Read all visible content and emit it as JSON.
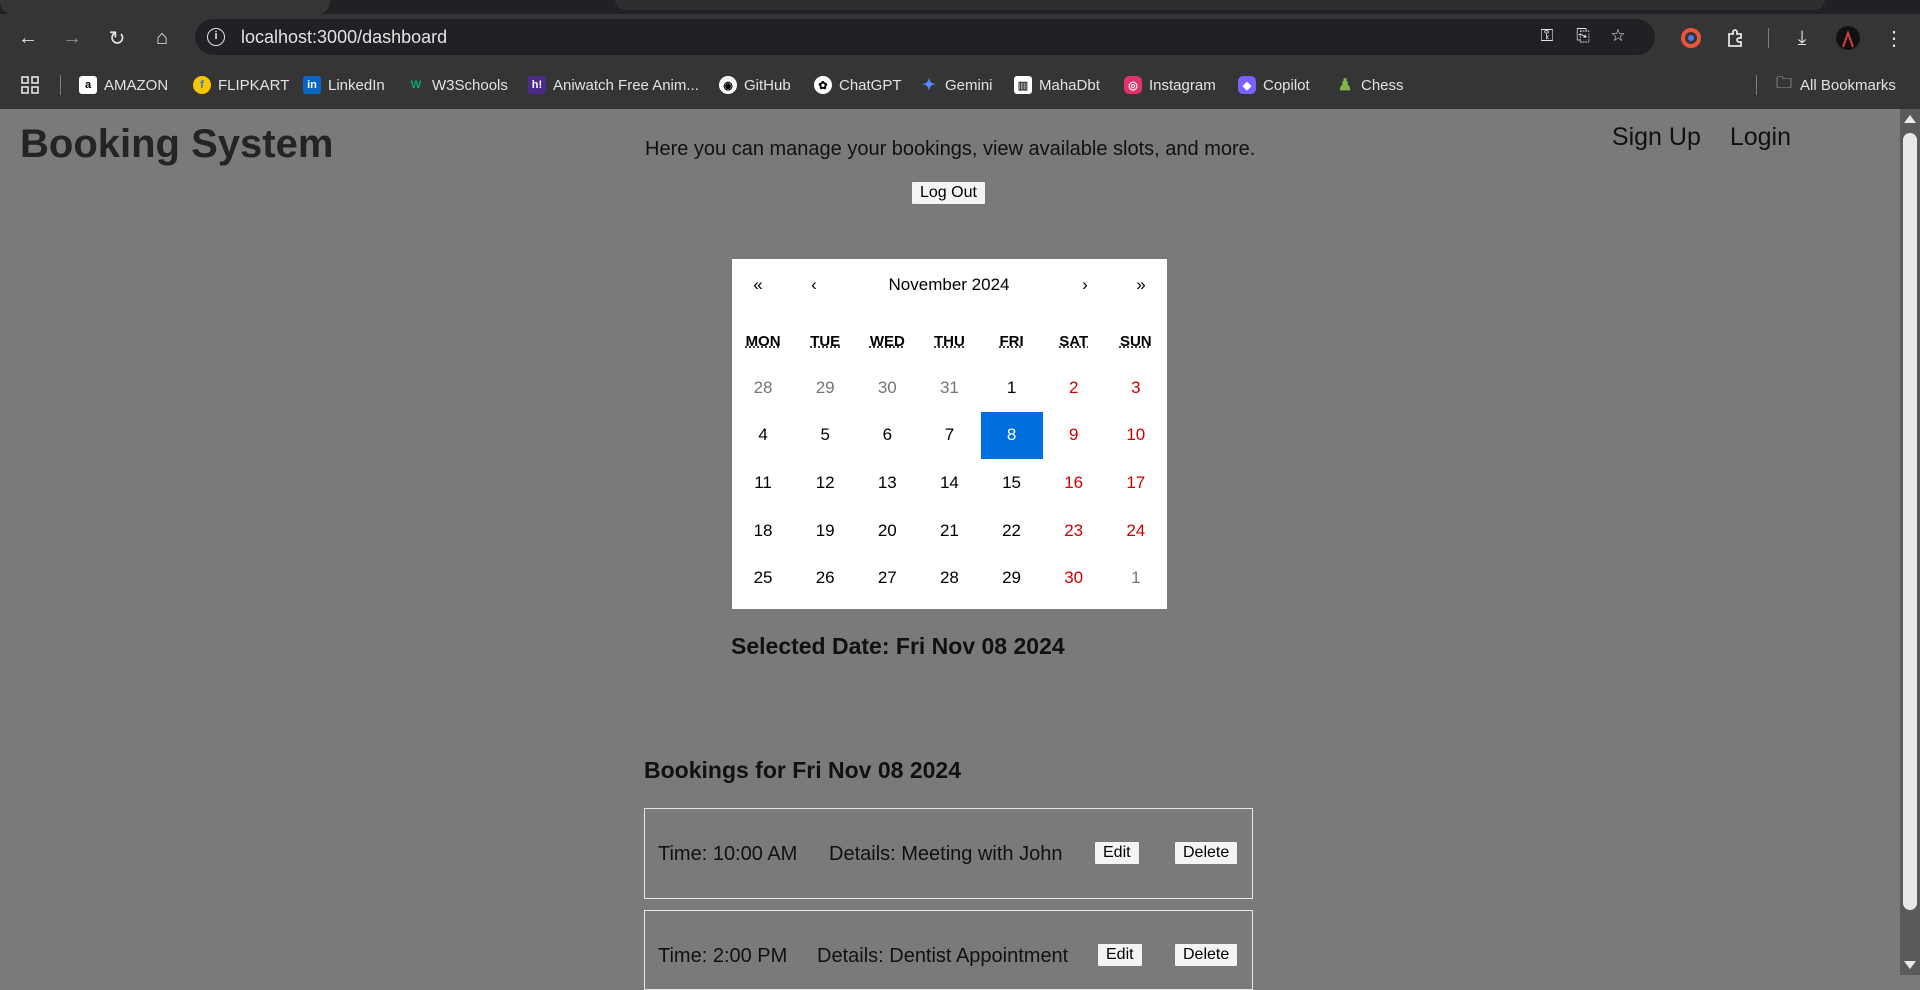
{
  "browser": {
    "url": "localhost:3000/dashboard",
    "bookmarks": [
      {
        "label": "AMAZON",
        "icon": "amazon-icon",
        "color": "#ffffff"
      },
      {
        "label": "FLIPKART",
        "icon": "flipkart-icon",
        "color": "#f7c600"
      },
      {
        "label": "LinkedIn",
        "icon": "linkedin-icon",
        "color": "#0a66c2"
      },
      {
        "label": "W3Schools",
        "icon": "w3schools-icon",
        "color": "#04aa6d"
      },
      {
        "label": "Aniwatch Free Anim...",
        "icon": "aniwatch-icon",
        "color": "#4a2a8a"
      },
      {
        "label": "GitHub",
        "icon": "github-icon",
        "color": "#ffffff"
      },
      {
        "label": "ChatGPT",
        "icon": "chatgpt-icon",
        "color": "#ffffff"
      },
      {
        "label": "Gemini",
        "icon": "gemini-icon",
        "color": "#4e8cff"
      },
      {
        "label": "MahaDbt",
        "icon": "mahadbt-icon",
        "color": "#ffffff"
      },
      {
        "label": "Instagram",
        "icon": "instagram-icon",
        "color": "#e1306c"
      },
      {
        "label": "Copilot",
        "icon": "copilot-icon",
        "color": "#7b61ff"
      },
      {
        "label": "Chess",
        "icon": "chess-icon",
        "color": "#81b64c"
      }
    ],
    "all_bookmarks": "All Bookmarks"
  },
  "header": {
    "brand": "Booking System",
    "nav": {
      "signup": "Sign Up",
      "login": "Login"
    }
  },
  "main": {
    "intro": "Here you can manage your bookings, view available slots, and more.",
    "logout_label": "Log Out",
    "calendar": {
      "nav_prev2": "«",
      "nav_prev": "‹",
      "label": "November 2024",
      "nav_next": "›",
      "nav_next2": "»",
      "weekdays": [
        "MON",
        "TUE",
        "WED",
        "THU",
        "FRI",
        "SAT",
        "SUN"
      ],
      "weeks": [
        [
          "28",
          "29",
          "30",
          "31",
          "1",
          "2",
          "3"
        ],
        [
          "4",
          "5",
          "6",
          "7",
          "8",
          "9",
          "10"
        ],
        [
          "11",
          "12",
          "13",
          "14",
          "15",
          "16",
          "17"
        ],
        [
          "18",
          "19",
          "20",
          "21",
          "22",
          "23",
          "24"
        ],
        [
          "25",
          "26",
          "27",
          "28",
          "29",
          "30",
          "1"
        ]
      ],
      "selected": "8",
      "accent": "#006edc",
      "weekend_color": "#d10000"
    },
    "selected_date_text": "Selected Date: Fri Nov 08 2024",
    "bookings_title": "Bookings for Fri Nov 08 2024",
    "bookings": [
      {
        "time": "Time: 10:00 AM",
        "details": "Details: Meeting with John",
        "edit": "Edit",
        "delete": "Delete"
      },
      {
        "time": "Time: 2:00 PM",
        "details": "Details: Dentist Appointment",
        "edit": "Edit",
        "delete": "Delete"
      }
    ]
  }
}
